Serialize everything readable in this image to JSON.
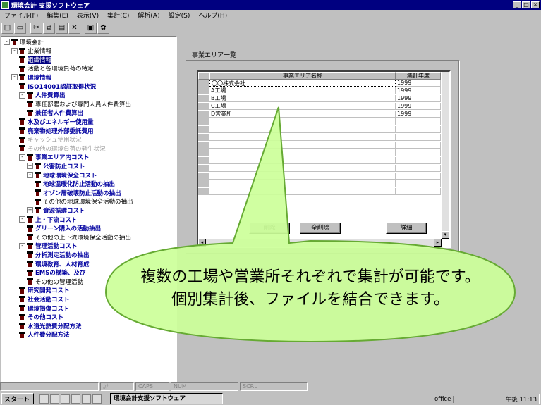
{
  "window": {
    "title": "環境会計 支援ソフトウェア",
    "controls": [
      "_",
      "□",
      "×"
    ]
  },
  "menu": {
    "items": [
      "ファイル(F)",
      "編集(E)",
      "表示(V)",
      "集計(C)",
      "解析(A)",
      "設定(S)",
      "ヘルプ(H)"
    ]
  },
  "toolbar": {
    "buttons": [
      {
        "icon": "new-file-icon",
        "glyph": "□"
      },
      {
        "icon": "open-folder-icon",
        "glyph": "▭"
      },
      {
        "icon": "cut-icon",
        "glyph": "✂"
      },
      {
        "icon": "copy-icon",
        "glyph": "⧉"
      },
      {
        "icon": "paste-icon",
        "glyph": "▤"
      },
      {
        "icon": "delete-icon",
        "glyph": "✕"
      },
      {
        "icon": "print-icon",
        "glyph": "▣"
      },
      {
        "icon": "help-icon",
        "glyph": "✿"
      }
    ]
  },
  "tree": {
    "nodes": [
      {
        "label": "環境会計",
        "style": "normal",
        "toggle": "-"
      },
      {
        "label": "企業情報",
        "style": "normal",
        "toggle": "-"
      },
      {
        "label": "組織情報",
        "style": "sel",
        "toggle": ""
      },
      {
        "label": "活動と各環境負荷の特定",
        "style": "normal",
        "toggle": ""
      },
      {
        "label": "環境情報",
        "style": "blue",
        "toggle": "-"
      },
      {
        "label": "ISO14001認証取得状況",
        "style": "blue",
        "toggle": ""
      },
      {
        "label": "人件費算出",
        "style": "blue",
        "toggle": "-"
      },
      {
        "label": "専任部署および専門人員人件費算出",
        "style": "normal",
        "toggle": ""
      },
      {
        "label": "兼任者人件費算出",
        "style": "blue",
        "toggle": ""
      },
      {
        "label": "水及びエネルギー使用量",
        "style": "blue",
        "toggle": ""
      },
      {
        "label": "廃棄物処理外部委託費用",
        "style": "blue",
        "toggle": ""
      },
      {
        "label": "キャッシュ使用状況",
        "style": "grey",
        "toggle": ""
      },
      {
        "label": "その他の環境負荷の発生状況",
        "style": "grey",
        "toggle": ""
      },
      {
        "label": "事業エリア内コスト",
        "style": "blue",
        "toggle": "-"
      },
      {
        "label": "公害防止コスト",
        "style": "blue",
        "toggle": "+"
      },
      {
        "label": "地球環境保全コスト",
        "style": "blue",
        "toggle": "-"
      },
      {
        "label": "地球温暖化防止活動の抽出",
        "style": "blue",
        "toggle": ""
      },
      {
        "label": "オゾン層破壊防止活動の抽出",
        "style": "blue",
        "toggle": ""
      },
      {
        "label": "その他の地球環境保全活動の抽出",
        "style": "normal",
        "toggle": ""
      },
      {
        "label": "資源循環コスト",
        "style": "blue",
        "toggle": "+"
      },
      {
        "label": "上・下流コスト",
        "style": "blue",
        "toggle": "-"
      },
      {
        "label": "グリーン購入の活動抽出",
        "style": "blue",
        "toggle": ""
      },
      {
        "label": "その他の上下流環境保全活動の抽出",
        "style": "normal",
        "toggle": ""
      },
      {
        "label": "管理活動コスト",
        "style": "blue",
        "toggle": "-"
      },
      {
        "label": "分析測定活動の抽出",
        "style": "blue",
        "toggle": ""
      },
      {
        "label": "環境教育、人材育成",
        "style": "blue",
        "toggle": ""
      },
      {
        "label": "EMSの構築、及び",
        "style": "blue",
        "toggle": ""
      },
      {
        "label": "その他の管理活動",
        "style": "normal",
        "toggle": ""
      },
      {
        "label": "研究開発コスト",
        "style": "blue",
        "toggle": ""
      },
      {
        "label": "社会活動コスト",
        "style": "blue",
        "toggle": ""
      },
      {
        "label": "環境損傷コスト",
        "style": "blue",
        "toggle": ""
      },
      {
        "label": "その他コスト",
        "style": "blue",
        "toggle": ""
      },
      {
        "label": "水道光熱費分配方法",
        "style": "blue",
        "toggle": ""
      },
      {
        "label": "人件費分配方法",
        "style": "blue",
        "toggle": ""
      }
    ]
  },
  "right_pane": {
    "section_label": "事業エリア一覧",
    "table": {
      "headers": [
        "事業エリア名称",
        "集計年度"
      ],
      "rows": [
        [
          "〇〇株式会社",
          "1999"
        ],
        [
          "A工場",
          "1999"
        ],
        [
          "B工場",
          "1999"
        ],
        [
          "C工場",
          "1999"
        ],
        [
          "D営業所",
          "1999"
        ]
      ]
    },
    "buttons": [
      "削除",
      "全削除",
      "詳細"
    ]
  },
  "statusbar": {
    "cells": [
      "ｶﾅ",
      "CAPS",
      "NUM",
      "SCRL"
    ]
  },
  "taskbar": {
    "start_label": "スタート",
    "task_label": "環境会計支援ソフトウェア",
    "office_label": "office",
    "clock": "午後 11:13"
  },
  "callout": {
    "line1": "複数の工場や営業所それぞれで集計が可能です。",
    "line2": "個別集計後、ファイルを結合できます。",
    "fill": "#ccff99",
    "stroke": "#66aa33"
  }
}
